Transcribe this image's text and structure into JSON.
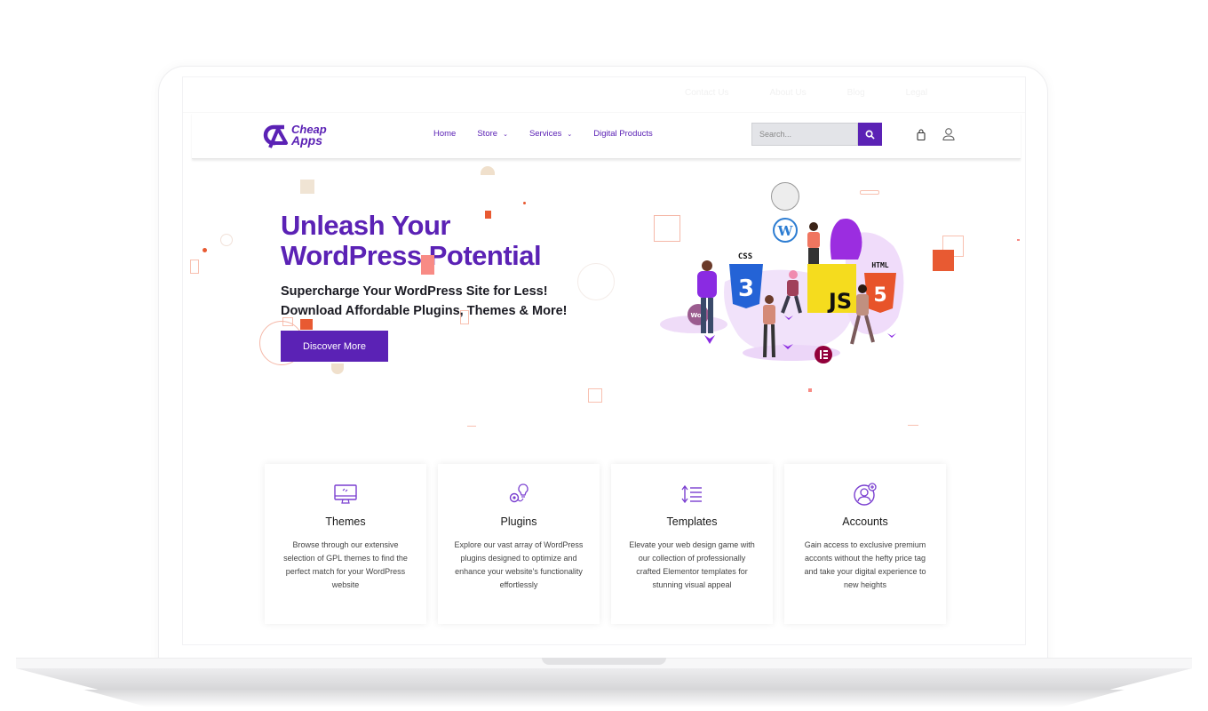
{
  "topbar": {
    "links": [
      "Contact Us",
      "About Us",
      "Blog",
      "Legal"
    ]
  },
  "header": {
    "logo": {
      "line1": "Cheap",
      "line2": "Apps"
    },
    "nav": [
      {
        "label": "Home",
        "has_dropdown": false
      },
      {
        "label": "Store",
        "has_dropdown": true
      },
      {
        "label": "Services",
        "has_dropdown": true
      },
      {
        "label": "Digital Products",
        "has_dropdown": false
      }
    ],
    "search": {
      "placeholder": "Search...",
      "value": ""
    },
    "icons": [
      "search-icon",
      "shopping-bag-icon",
      "user-icon"
    ]
  },
  "hero": {
    "title_line1": "Unleash Your",
    "title_line2": "WordPress Potential",
    "subtitle_line1": "Supercharge Your WordPress Site for Less!",
    "subtitle_line2": "Download Affordable Plugins, Themes & More!",
    "cta_label": "Discover More",
    "illustration_labels": {
      "css": "CSS",
      "js": "JS",
      "html": "HTML",
      "woo": "Woo"
    }
  },
  "cards": [
    {
      "icon": "monitor-icon",
      "title": "Themes",
      "desc": "Browse through our extensive selection of GPL themes to find the perfect match for your WordPress website"
    },
    {
      "icon": "plugin-bulb-icon",
      "title": "Plugins",
      "desc": "Explore our vast array of WordPress plugins designed to optimize and enhance your website's functionality effortlessly"
    },
    {
      "icon": "template-list-icon",
      "title": "Templates",
      "desc": "Elevate your web design game with our collection of professionally crafted Elementor templates for stunning visual appeal"
    },
    {
      "icon": "account-user-icon",
      "title": "Accounts",
      "desc": "Gain access to exclusive premium acconts without the hefty price tag and take your digital experience to new heights"
    }
  ],
  "colors": {
    "brand": "#5b22b5",
    "accent_orange": "#e85a32",
    "accent_pink": "#f88b85",
    "text_dark": "#1a1a22"
  }
}
